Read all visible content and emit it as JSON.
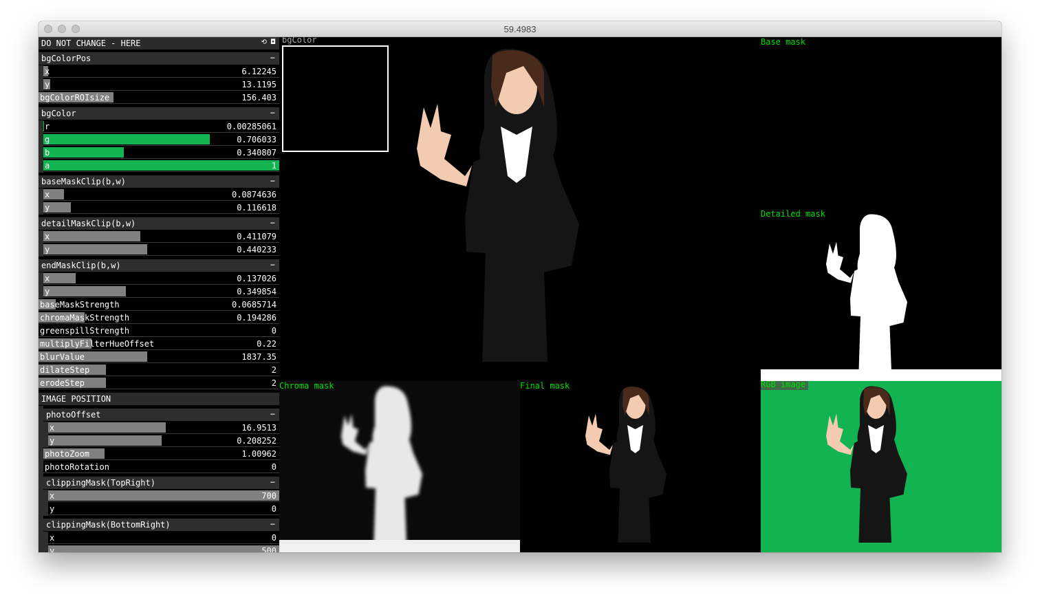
{
  "window": {
    "title": "59.4983"
  },
  "gui": {
    "title": "DO NOT CHANGE - HERE",
    "title_icons": "⟲ ◘",
    "minimize": "−",
    "bgColorPos": {
      "label": "bgColorPos",
      "x": "6.12245",
      "y": "13.1195"
    },
    "bgColorROIsize": {
      "label": "bgColorROIsize",
      "value": "156.403"
    },
    "bgColor": {
      "label": "bgColor",
      "r": "0.00285061",
      "g": "0.706033",
      "b": "0.340807",
      "a": "1"
    },
    "baseMaskClip": {
      "label": "baseMaskClip(b,w)",
      "x": "0.0874636",
      "y": "0.116618"
    },
    "detailMaskClip": {
      "label": "detailMaskClip(b,w)",
      "x": "0.411079",
      "y": "0.440233"
    },
    "endMaskClip": {
      "label": "endMaskClip(b,w)",
      "x": "0.137026",
      "y": "0.349854"
    },
    "baseMaskStrength": {
      "label": "baseMaskStrength",
      "value": "0.0685714"
    },
    "chromaMaskStrength": {
      "label": "chromaMaskStrength",
      "value": "0.194286"
    },
    "greenspillStrength": {
      "label": "greenspillStrength",
      "value": "0"
    },
    "multiplyFilterHueOffset": {
      "label": "multiplyFilterHueOffset",
      "value": "0.22"
    },
    "blurValue": {
      "label": "blurValue",
      "value": "1837.35"
    },
    "dilateStep": {
      "label": "dilateStep",
      "value": "2"
    },
    "erodeStep": {
      "label": "erodeStep",
      "value": "2"
    },
    "imagePosition": {
      "label": "IMAGE POSITION"
    },
    "photoOffset": {
      "label": "photoOffset",
      "x": "16.9513",
      "y": "0.208252"
    },
    "photoZoom": {
      "label": "photoZoom",
      "value": "1.00962"
    },
    "photoRotation": {
      "label": "photoRotation",
      "value": "0"
    },
    "clippingMaskTR": {
      "label": "clippingMask(TopRight)",
      "x": "700",
      "y": "0"
    },
    "clippingMaskBR": {
      "label": "clippingMask(BottomRight)",
      "x": "0",
      "y": "500"
    },
    "axis": {
      "x": "x",
      "y": "y",
      "r": "r",
      "g": "g",
      "b": "b",
      "a": "a"
    },
    "fill_fractions": {
      "bgColorPos_x": 0.02,
      "bgColorPos_y": 0.03,
      "bgColorROIsize": 0.31,
      "bgColor_r": 0.003,
      "bgColor_g": 0.706,
      "bgColor_b": 0.341,
      "bgColor_a": 1,
      "baseMaskClip_x": 0.087,
      "baseMaskClip_y": 0.117,
      "detailMaskClip_x": 0.411,
      "detailMaskClip_y": 0.44,
      "endMaskClip_x": 0.137,
      "endMaskClip_y": 0.35,
      "baseMaskStrength": 0.07,
      "chromaMaskStrength": 0.19,
      "greenspillStrength": 0,
      "multiplyFilterHueOffset": 0.22,
      "blurValue": 0.45,
      "dilateStep": 0.28,
      "erodeStep": 0.28,
      "photoOffset_x": 0.51,
      "photoOffset_y": 0.49,
      "photoZoom": 0.26,
      "photoRotation": 0,
      "clippingMaskTR_x": 1,
      "clippingMaskTR_y": 0,
      "clippingMaskBR_x": 0,
      "clippingMaskBR_y": 1
    }
  },
  "views": {
    "bgColor": "bgColor",
    "base_mask": "Base mask",
    "detailed_mask": "Detailed mask",
    "chroma_mask": "Chroma mask",
    "final_mask": "Final mask",
    "rgb_image": "RGB image"
  },
  "colors": {
    "green": "#12b451",
    "label_green": "#00e000",
    "slider_grey": "#808080"
  }
}
